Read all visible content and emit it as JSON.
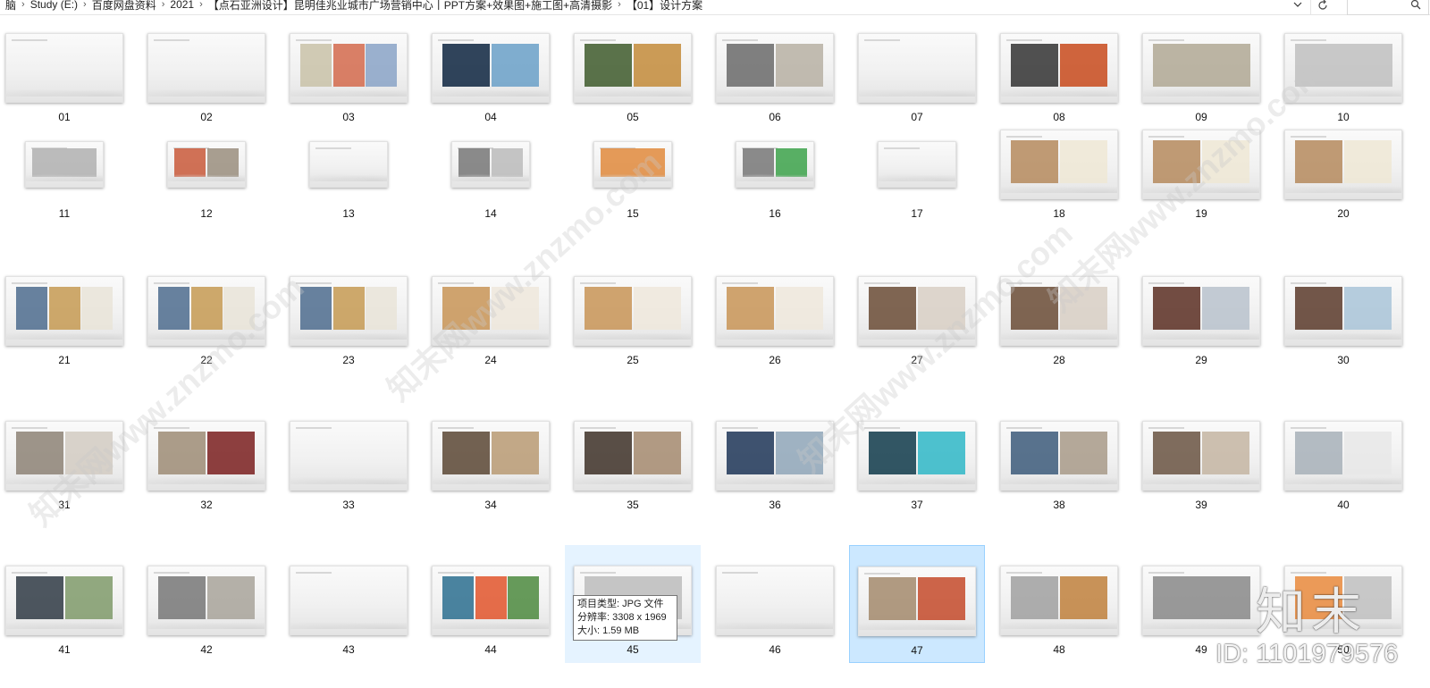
{
  "address_bar": {
    "breadcrumbs": [
      "脑",
      "Study (E:)",
      "百度网盘资料",
      "2021",
      "【点石亚洲设计】昆明佳兆业城市广场营销中心丨PPT方案+效果图+施工图+高清摄影",
      "【01】设计方案"
    ]
  },
  "tooltip": {
    "lines": [
      "项目类型: JPG 文件",
      "分辨率: 3308 x 1969",
      "大小: 1.59 MB"
    ]
  },
  "watermark": {
    "mark_text": "知末",
    "id_text": "ID: 1101979576",
    "diagonal_text": "知末网www.znzmo.com"
  },
  "files": {
    "labels": [
      "01",
      "02",
      "03",
      "04",
      "05",
      "06",
      "07",
      "08",
      "09",
      "10",
      "11",
      "12",
      "13",
      "14",
      "15",
      "16",
      "17",
      "18",
      "19",
      "20",
      "21",
      "22",
      "23",
      "24",
      "25",
      "26",
      "27",
      "28",
      "29",
      "30",
      "31",
      "32",
      "33",
      "34",
      "35",
      "36",
      "37",
      "38",
      "39",
      "40",
      "41",
      "42",
      "43",
      "44",
      "45",
      "46",
      "47",
      "48",
      "49",
      "50"
    ],
    "selected": "47",
    "hovered": "45"
  },
  "colors": {
    "selection_bg": "#cce8ff",
    "selection_border": "#99d1ff",
    "hover_bg": "#e5f3ff"
  },
  "icons": [
    "chevron-right-icon",
    "chevron-down-icon",
    "refresh-icon",
    "search-icon"
  ]
}
